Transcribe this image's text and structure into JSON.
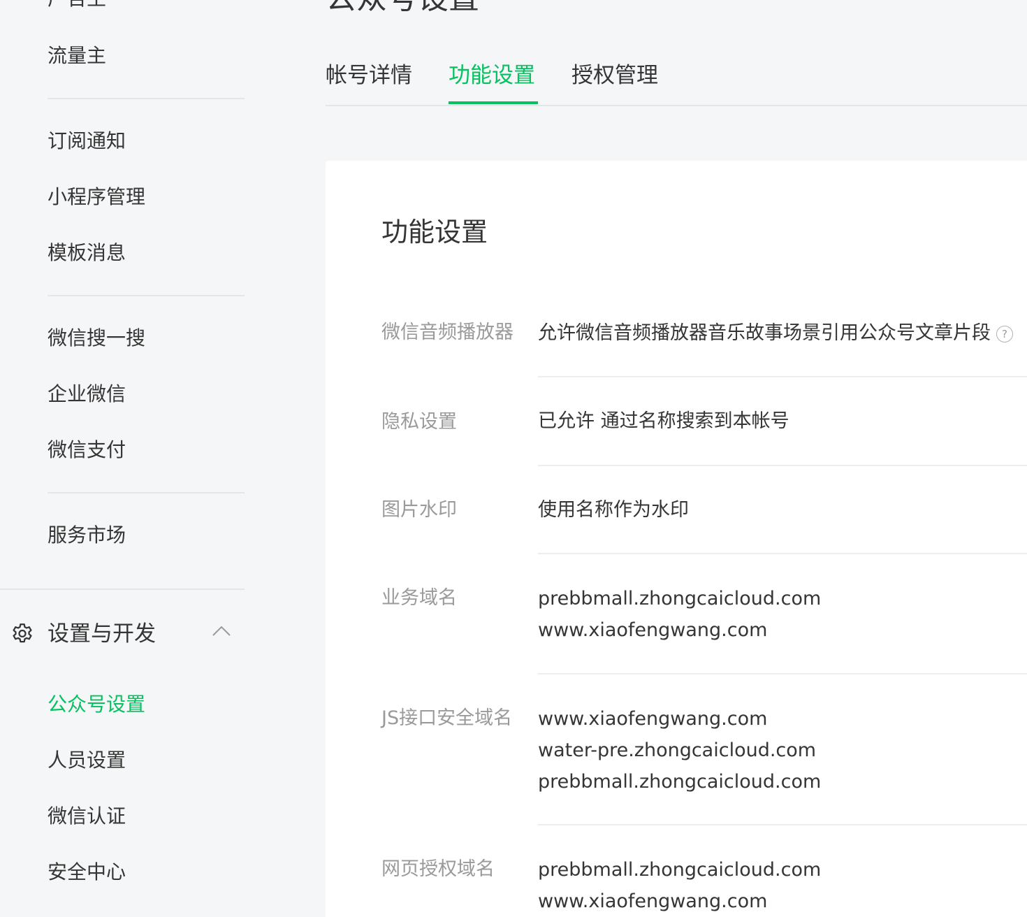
{
  "sidebar": {
    "partial_top_item": "广告主",
    "items": [
      {
        "label": "流量主"
      },
      {
        "label": "订阅通知"
      },
      {
        "label": "小程序管理"
      },
      {
        "label": "模板消息"
      },
      {
        "label": "微信搜一搜"
      },
      {
        "label": "企业微信"
      },
      {
        "label": "微信支付"
      },
      {
        "label": "服务市场"
      }
    ],
    "group": {
      "label": "设置与开发",
      "icon": "gear-icon",
      "expanded_icon": "chevron-up-icon",
      "children": [
        {
          "label": "公众号设置",
          "active": true
        },
        {
          "label": "人员设置"
        },
        {
          "label": "微信认证"
        },
        {
          "label": "安全中心"
        }
      ]
    }
  },
  "header": {
    "title": "公众号设置"
  },
  "tabs": [
    {
      "label": "帐号详情",
      "active": false
    },
    {
      "label": "功能设置",
      "active": true
    },
    {
      "label": "授权管理",
      "active": false
    }
  ],
  "card": {
    "title": "功能设置",
    "rows": [
      {
        "label": "微信音频播放器",
        "values": [
          "允许微信音频播放器音乐故事场景引用公众号文章片段"
        ],
        "help_icon": "?"
      },
      {
        "label": "隐私设置",
        "values": [
          "已允许 通过名称搜索到本帐号"
        ]
      },
      {
        "label": "图片水印",
        "values": [
          "使用名称作为水印"
        ]
      },
      {
        "label": "业务域名",
        "values": [
          "prebbmall.zhongcaicloud.com",
          "www.xiaofengwang.com"
        ]
      },
      {
        "label": "JS接口安全域名",
        "values": [
          "www.xiaofengwang.com",
          "water-pre.zhongcaicloud.com",
          "prebbmall.zhongcaicloud.com"
        ]
      },
      {
        "label": "网页授权域名",
        "values": [
          "prebbmall.zhongcaicloud.com",
          "www.xiaofengwang.com"
        ]
      }
    ]
  },
  "colors": {
    "accent": "#07c160",
    "text": "#353535",
    "muted": "#9a9a9a",
    "background": "#f5f6f7"
  }
}
